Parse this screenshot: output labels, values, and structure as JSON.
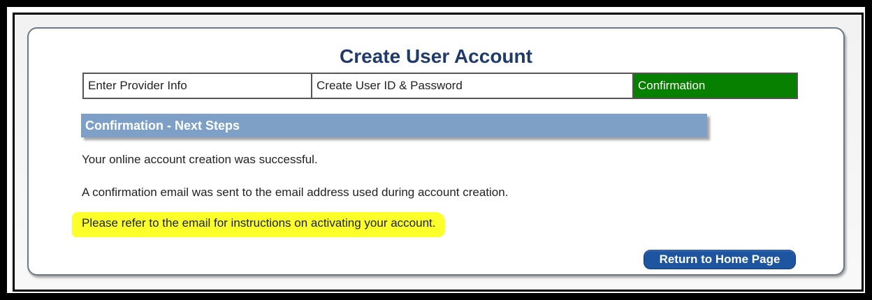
{
  "page": {
    "title": "Create User Account"
  },
  "steps": [
    {
      "label": "Enter Provider Info"
    },
    {
      "label": "Create User ID & Password"
    },
    {
      "label": "Confirmation"
    }
  ],
  "section": {
    "header": "Confirmation - Next Steps",
    "messages": [
      "Your online account creation was successful.",
      "A confirmation email was sent to the email address used during account creation.",
      "Please refer to the email for instructions on activating your account."
    ]
  },
  "actions": {
    "home_button_label": "Return to Home Page"
  },
  "colors": {
    "active_step": "#078000",
    "section_header": "#7ea0c6",
    "title": "#1f3a6b",
    "button": "#1d55a0",
    "highlight": "#fbff2a"
  }
}
